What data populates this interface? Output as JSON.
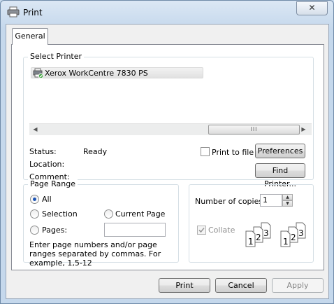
{
  "window": {
    "title": "Print",
    "close_glyph": "✕"
  },
  "tabs": [
    {
      "label": "General"
    }
  ],
  "select_printer": {
    "group_label": "Select Printer",
    "printers": [
      {
        "name": "Xerox WorkCentre 7830 PS",
        "icon": "printer-icon"
      }
    ],
    "scroll_thumb_glyph": "III",
    "status_label": "Status:",
    "status_value": "Ready",
    "location_label": "Location:",
    "location_value": "",
    "comment_label": "Comment:",
    "comment_value": "",
    "print_to_file_label": "Print to file",
    "print_to_file_checked": false,
    "preferences_label": "Preferences",
    "find_printer_label": "Find Printer..."
  },
  "page_range": {
    "group_label": "Page Range",
    "all_label": "All",
    "selection_label": "Selection",
    "current_page_label": "Current Page",
    "pages_label": "Pages:",
    "pages_value": "",
    "selected": "all",
    "hint": "Enter page numbers and/or page ranges separated by commas.  For example, 1,5-12"
  },
  "copies": {
    "number_label": "Number of copies:",
    "number_value": "1",
    "collate_label": "Collate",
    "collate_checked": true,
    "collate_pages": [
      "1",
      "2",
      "3",
      "1",
      "2",
      "3"
    ]
  },
  "buttons": {
    "print": "Print",
    "cancel": "Cancel",
    "apply": "Apply"
  },
  "colors": {
    "radio_dot": "#1b54b5",
    "title_gradient_top": "#dbe7f4",
    "tab_border": "#898c95"
  }
}
